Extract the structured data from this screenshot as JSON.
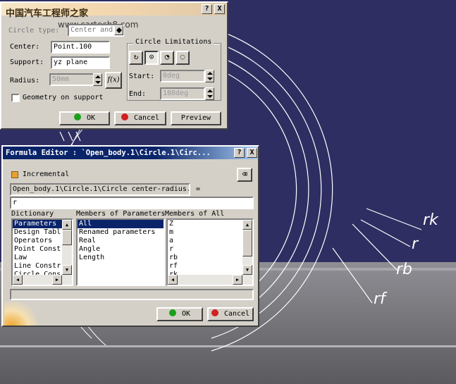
{
  "watermark": {
    "title": "中国汽车工程师之家",
    "url": "www.cartech8.com"
  },
  "circle_dialog": {
    "circle_type_label": "Circle type:",
    "circle_type_value": "Center and",
    "center_label": "Center:",
    "center_value": "Point.100",
    "support_label": "Support:",
    "support_value": "yz plane",
    "radius_label": "Radius:",
    "radius_value": "50mm",
    "formula_button": "f(x)",
    "geometry_on_support": "Geometry on support",
    "limitations_title": "Circle Limitations",
    "start_label": "Start:",
    "start_value": "0deg",
    "end_label": "End:",
    "end_value": "180deg",
    "ok": "OK",
    "cancel": "Cancel",
    "preview": "Preview",
    "help_glyph": "?",
    "close_glyph": "X"
  },
  "formula_editor": {
    "title": "Formula Editor : `Open_body.1\\Circle.1\\Circ...",
    "incremental": "Incremental",
    "parameter_path": "Open_body.1\\Circle.1\\Circle center-radius.",
    "equals": "=",
    "formula": "r",
    "dictionary_header": "Dictionary",
    "dictionary": [
      "Parameters",
      "Design Tabl",
      "Operators",
      "Point Const",
      "Law",
      "Line Constr",
      "Circle Cons"
    ],
    "members_params_header": "Members of Parameters",
    "members_params": [
      "All",
      "Renamed parameters",
      "Real",
      "Angle",
      "Length"
    ],
    "members_all_header": "Members of All",
    "members_all": [
      "Z",
      "m",
      "a",
      "r",
      "rb",
      "rf",
      "rk"
    ],
    "ok": "OK",
    "cancel": "Cancel",
    "help_glyph": "?",
    "close_glyph": "X"
  },
  "annotations": {
    "rk": "rk",
    "r": "r",
    "rb": "rb",
    "rf": "rf"
  },
  "colors": {
    "background": "#2e2e62",
    "selection": "#0a246a",
    "dialog": "#d4d0c8",
    "annotation": "#e02020"
  }
}
